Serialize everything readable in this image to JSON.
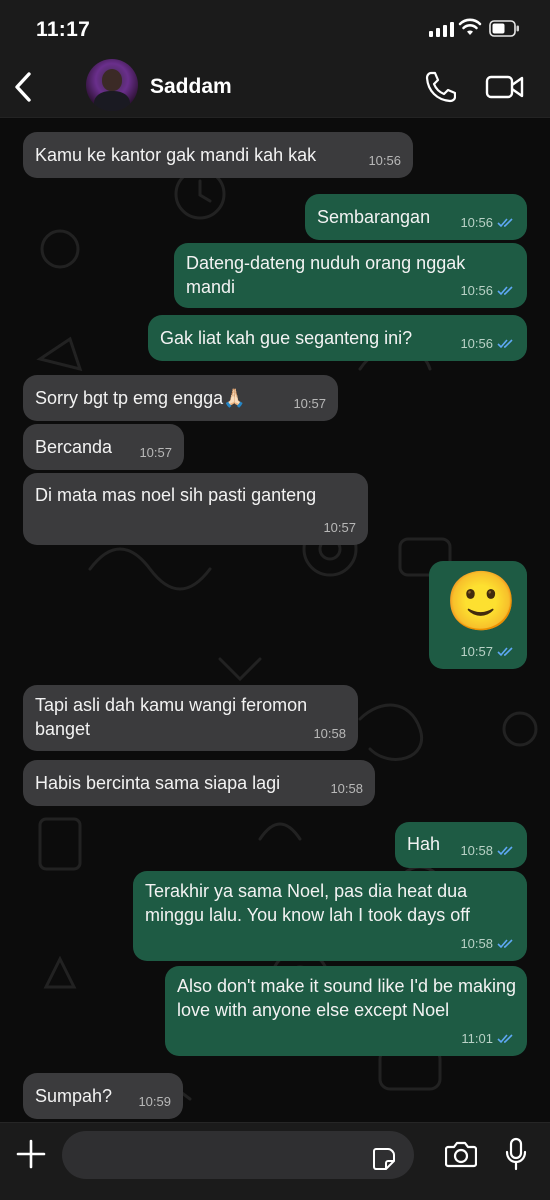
{
  "status_bar": {
    "time": "11:17"
  },
  "header": {
    "contact_name": "Saddam"
  },
  "messages": [
    {
      "dir": "in",
      "text": "Kamu ke kantor gak mandi kah kak",
      "time": "10:56"
    },
    {
      "dir": "out",
      "text": "Sembarangan",
      "time": "10:56"
    },
    {
      "dir": "out",
      "text": "Dateng-dateng nuduh orang nggak mandi",
      "time": "10:56"
    },
    {
      "dir": "out",
      "text": "Gak liat kah gue seganteng ini?",
      "time": "10:56"
    },
    {
      "dir": "in",
      "text": "Sorry bgt tp emg engga🙏🏻",
      "time": "10:57"
    },
    {
      "dir": "in",
      "text": "Bercanda",
      "time": "10:57"
    },
    {
      "dir": "in",
      "text": "Di mata mas noel sih pasti ganteng",
      "time": "10:57"
    },
    {
      "dir": "out",
      "text": "🙂",
      "time": "10:57"
    },
    {
      "dir": "in",
      "text": "Tapi asli dah kamu wangi feromon banget",
      "time": "10:58"
    },
    {
      "dir": "in",
      "text": "Habis bercinta sama siapa lagi",
      "time": "10:58"
    },
    {
      "dir": "out",
      "text": "Hah",
      "time": "10:58"
    },
    {
      "dir": "out",
      "text": "Terakhir ya sama Noel, pas dia heat dua minggu lalu. You know lah I took days off",
      "time": "10:58"
    },
    {
      "dir": "out",
      "text": "Also don't make it sound like I'd be making love with anyone else except Noel",
      "time": "11:01"
    },
    {
      "dir": "in",
      "text": "Sumpah?",
      "time": "10:59"
    }
  ],
  "input": {
    "placeholder": ""
  },
  "colors": {
    "incoming": "#3b3b3d",
    "outgoing": "#1e5b44",
    "read_tick": "#5fa8f5"
  }
}
